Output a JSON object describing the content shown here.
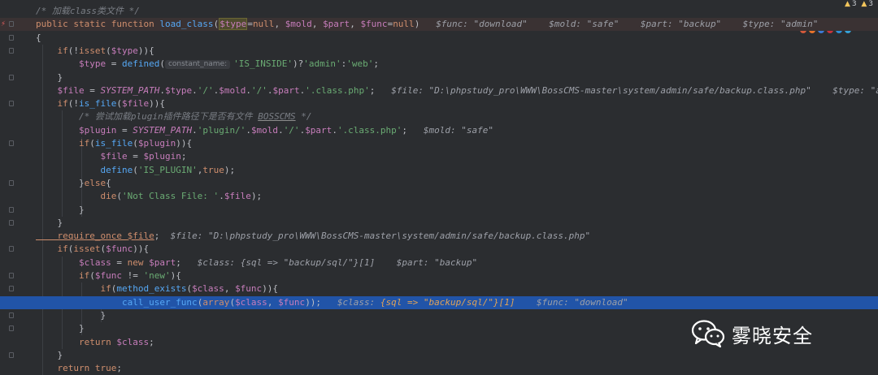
{
  "status": {
    "warnings": "3",
    "weak_warnings": "3"
  },
  "watermark": {
    "brand": "雾晓安全"
  },
  "lines": [
    {
      "segs": [
        {
          "c": "cm",
          "t": "/* 加载class类文件 */"
        }
      ]
    },
    {
      "segs": [
        {
          "c": "kw",
          "t": "public static function "
        },
        {
          "c": "fn",
          "t": "load_class"
        },
        {
          "c": "punc",
          "t": "("
        },
        {
          "c": "var hl",
          "t": "$type"
        },
        {
          "c": "punc",
          "t": "="
        },
        {
          "c": "kw",
          "t": "null"
        },
        {
          "c": "punc",
          "t": ", "
        },
        {
          "c": "var",
          "t": "$mold"
        },
        {
          "c": "punc",
          "t": ", "
        },
        {
          "c": "var",
          "t": "$part"
        },
        {
          "c": "punc",
          "t": ", "
        },
        {
          "c": "var",
          "t": "$func"
        },
        {
          "c": "punc",
          "t": "="
        },
        {
          "c": "kw",
          "t": "null"
        },
        {
          "c": "punc",
          "t": ")   "
        },
        {
          "c": "hint",
          "t": "$func: \"download\"    $mold: \"safe\"    $part: \"backup\"    $type: \"admin\""
        }
      ]
    },
    {
      "segs": [
        {
          "c": "punc",
          "t": "{"
        }
      ]
    },
    {
      "segs": [
        {
          "c": "kw",
          "t": "    if"
        },
        {
          "c": "punc",
          "t": "(!"
        },
        {
          "c": "kw",
          "t": "isset"
        },
        {
          "c": "punc",
          "t": "("
        },
        {
          "c": "var",
          "t": "$type"
        },
        {
          "c": "punc",
          "t": ")){"
        }
      ]
    },
    {
      "segs": [
        {
          "c": "var",
          "t": "        $type"
        },
        {
          "c": "punc",
          "t": " = "
        },
        {
          "c": "fn",
          "t": "defined"
        },
        {
          "c": "punc",
          "t": "("
        },
        {
          "c": "pnh",
          "t": "constant_name:"
        },
        {
          "c": "str",
          "t": "'IS_INSIDE'"
        },
        {
          "c": "punc",
          "t": ")?"
        },
        {
          "c": "str",
          "t": "'admin'"
        },
        {
          "c": "punc",
          "t": ":"
        },
        {
          "c": "str",
          "t": "'web'"
        },
        {
          "c": "punc",
          "t": ";"
        }
      ]
    },
    {
      "segs": [
        {
          "c": "punc",
          "t": "    }"
        }
      ]
    },
    {
      "segs": [
        {
          "c": "var",
          "t": "    $file"
        },
        {
          "c": "punc",
          "t": " = "
        },
        {
          "c": "cst",
          "t": "SYSTEM_PATH"
        },
        {
          "c": "punc",
          "t": "."
        },
        {
          "c": "var",
          "t": "$type"
        },
        {
          "c": "punc",
          "t": "."
        },
        {
          "c": "str",
          "t": "'/'"
        },
        {
          "c": "punc",
          "t": "."
        },
        {
          "c": "var",
          "t": "$mold"
        },
        {
          "c": "punc",
          "t": "."
        },
        {
          "c": "str",
          "t": "'/'"
        },
        {
          "c": "punc",
          "t": "."
        },
        {
          "c": "var",
          "t": "$part"
        },
        {
          "c": "punc",
          "t": "."
        },
        {
          "c": "str",
          "t": "'.class.php'"
        },
        {
          "c": "punc",
          "t": ";   "
        },
        {
          "c": "hint",
          "t": "$file: \"D:\\phpstudy_pro\\WWW\\BossCMS-master\\system/admin/safe/backup.class.php\"    $type: \"admin\""
        }
      ]
    },
    {
      "segs": [
        {
          "c": "kw",
          "t": "    if"
        },
        {
          "c": "punc",
          "t": "(!"
        },
        {
          "c": "fn",
          "t": "is_file"
        },
        {
          "c": "punc",
          "t": "("
        },
        {
          "c": "var",
          "t": "$file"
        },
        {
          "c": "punc",
          "t": ")){"
        }
      ]
    },
    {
      "segs": [
        {
          "c": "cm",
          "t": "        /* 尝试加载plugin插件路径下是否有文件 "
        },
        {
          "c": "cm ul",
          "t": "BOSSCMS"
        },
        {
          "c": "cm",
          "t": " */"
        }
      ]
    },
    {
      "segs": [
        {
          "c": "var",
          "t": "        $plugin"
        },
        {
          "c": "punc",
          "t": " = "
        },
        {
          "c": "cst",
          "t": "SYSTEM_PATH"
        },
        {
          "c": "punc",
          "t": "."
        },
        {
          "c": "str",
          "t": "'plugin/'"
        },
        {
          "c": "punc",
          "t": "."
        },
        {
          "c": "var",
          "t": "$mold"
        },
        {
          "c": "punc",
          "t": "."
        },
        {
          "c": "str",
          "t": "'/'"
        },
        {
          "c": "punc",
          "t": "."
        },
        {
          "c": "var",
          "t": "$part"
        },
        {
          "c": "punc",
          "t": "."
        },
        {
          "c": "str",
          "t": "'.class.php'"
        },
        {
          "c": "punc",
          "t": ";   "
        },
        {
          "c": "hint",
          "t": "$mold: \"safe\""
        }
      ]
    },
    {
      "segs": [
        {
          "c": "kw",
          "t": "        if"
        },
        {
          "c": "punc",
          "t": "("
        },
        {
          "c": "fn",
          "t": "is_file"
        },
        {
          "c": "punc",
          "t": "("
        },
        {
          "c": "var",
          "t": "$plugin"
        },
        {
          "c": "punc",
          "t": ")){"
        }
      ]
    },
    {
      "segs": [
        {
          "c": "var",
          "t": "            $file"
        },
        {
          "c": "punc",
          "t": " = "
        },
        {
          "c": "var",
          "t": "$plugin"
        },
        {
          "c": "punc",
          "t": ";"
        }
      ]
    },
    {
      "segs": [
        {
          "c": "fn",
          "t": "            define"
        },
        {
          "c": "punc",
          "t": "("
        },
        {
          "c": "str",
          "t": "'IS_PLUGIN'"
        },
        {
          "c": "punc",
          "t": ","
        },
        {
          "c": "kw",
          "t": "true"
        },
        {
          "c": "punc",
          "t": ");"
        }
      ]
    },
    {
      "segs": [
        {
          "c": "punc",
          "t": "        }"
        },
        {
          "c": "kw",
          "t": "else"
        },
        {
          "c": "punc",
          "t": "{"
        }
      ]
    },
    {
      "segs": [
        {
          "c": "kw",
          "t": "            die"
        },
        {
          "c": "punc",
          "t": "("
        },
        {
          "c": "str",
          "t": "'Not Class File: '"
        },
        {
          "c": "punc",
          "t": "."
        },
        {
          "c": "var",
          "t": "$file"
        },
        {
          "c": "punc",
          "t": ");"
        }
      ]
    },
    {
      "segs": [
        {
          "c": "punc",
          "t": "        }"
        }
      ]
    },
    {
      "segs": [
        {
          "c": "punc",
          "t": "    }"
        }
      ]
    },
    {
      "segs": [
        {
          "c": "kw warn",
          "t": "    require_once "
        },
        {
          "c": "var warn",
          "t": "$file"
        },
        {
          "c": "punc",
          "t": ";  "
        },
        {
          "c": "hint",
          "t": "$file: \"D:\\phpstudy_pro\\WWW\\BossCMS-master\\system/admin/safe/backup.class.php\""
        }
      ]
    },
    {
      "segs": [
        {
          "c": "kw",
          "t": "    if"
        },
        {
          "c": "punc",
          "t": "("
        },
        {
          "c": "kw",
          "t": "isset"
        },
        {
          "c": "punc",
          "t": "("
        },
        {
          "c": "var",
          "t": "$func"
        },
        {
          "c": "punc",
          "t": ")){"
        }
      ]
    },
    {
      "segs": [
        {
          "c": "var",
          "t": "        $class"
        },
        {
          "c": "punc",
          "t": " = "
        },
        {
          "c": "kw",
          "t": "new "
        },
        {
          "c": "var",
          "t": "$part"
        },
        {
          "c": "punc",
          "t": ";   "
        },
        {
          "c": "hint",
          "t": "$class: {sql => \"backup/sql/\"}[1]    $part: \"backup\""
        }
      ]
    },
    {
      "segs": [
        {
          "c": "kw",
          "t": "        if"
        },
        {
          "c": "punc",
          "t": "("
        },
        {
          "c": "var",
          "t": "$func"
        },
        {
          "c": "punc",
          "t": " != "
        },
        {
          "c": "str",
          "t": "'new'"
        },
        {
          "c": "punc",
          "t": "){"
        }
      ]
    },
    {
      "segs": [
        {
          "c": "kw",
          "t": "            if"
        },
        {
          "c": "punc",
          "t": "("
        },
        {
          "c": "fn",
          "t": "method_exists"
        },
        {
          "c": "punc",
          "t": "("
        },
        {
          "c": "var",
          "t": "$class"
        },
        {
          "c": "punc",
          "t": ", "
        },
        {
          "c": "var",
          "t": "$func"
        },
        {
          "c": "punc",
          "t": ")){"
        }
      ]
    },
    {
      "segs": [
        {
          "c": "fn",
          "t": "                call_user_func"
        },
        {
          "c": "punc",
          "t": "("
        },
        {
          "c": "kw",
          "t": "array"
        },
        {
          "c": "punc",
          "t": "("
        },
        {
          "c": "var",
          "t": "$class"
        },
        {
          "c": "punc",
          "t": ", "
        },
        {
          "c": "var",
          "t": "$func"
        },
        {
          "c": "punc",
          "t": "));   "
        },
        {
          "c": "hint",
          "t": "$class: "
        },
        {
          "c": "hint-o",
          "t": "{sql => \"backup/sql/\"}[1]"
        },
        {
          "c": "hint",
          "t": "    $func: \"download\""
        }
      ]
    },
    {
      "segs": [
        {
          "c": "punc",
          "t": "            }"
        }
      ]
    },
    {
      "segs": [
        {
          "c": "punc",
          "t": "        }"
        }
      ]
    },
    {
      "segs": [
        {
          "c": "kw",
          "t": "        return "
        },
        {
          "c": "var",
          "t": "$class"
        },
        {
          "c": "punc",
          "t": ";"
        }
      ]
    },
    {
      "segs": [
        {
          "c": "punc",
          "t": "    }"
        }
      ]
    },
    {
      "segs": [
        {
          "c": "kw",
          "t": "    return true"
        },
        {
          "c": "punc",
          "t": ";"
        }
      ]
    }
  ]
}
